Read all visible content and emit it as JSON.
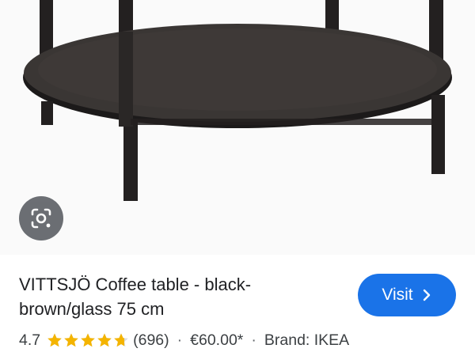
{
  "product": {
    "title": "VITTSJÖ Coffee table - black-brown/glass 75 cm",
    "rating": "4.7",
    "rating_value": 4.7,
    "rating_max": 5,
    "review_count": "(696)",
    "price": "€60.00*",
    "brand": "Brand: IKEA",
    "separator": "·"
  },
  "actions": {
    "visit_label": "Visit",
    "visit_icon": "chevron-right-icon",
    "lens_icon": "google-lens-icon"
  },
  "colors": {
    "visit_button": "#1a73e8",
    "star": "#f4b400",
    "lens_button": "#5f6368",
    "title_text": "#202124"
  }
}
